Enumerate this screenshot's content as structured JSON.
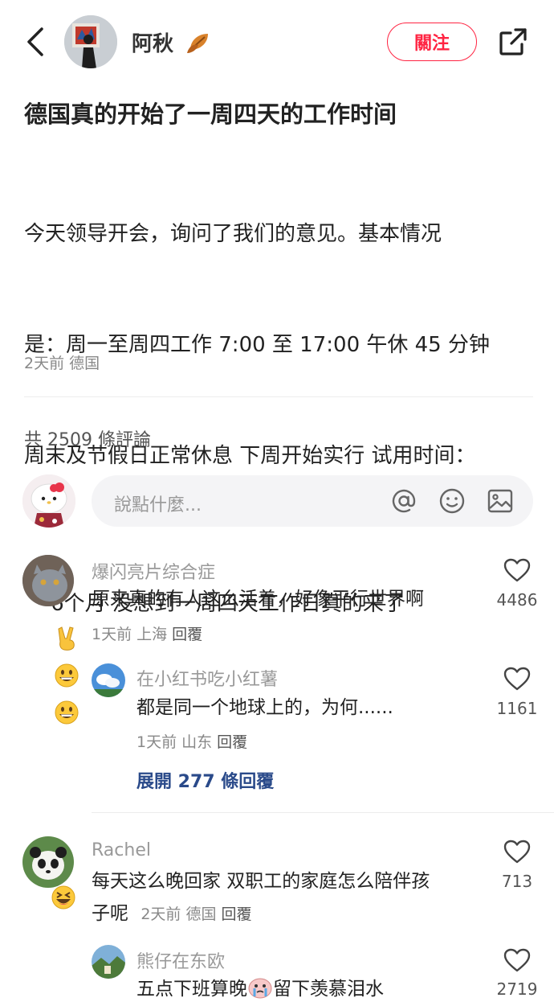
{
  "header": {
    "author_name": "阿秋",
    "follow_label": "關注"
  },
  "post": {
    "title": "德国真的开始了一周四天的工作时间",
    "body_line1": "今天领导开会，询问了我们的意见。基本情况",
    "body_line2": "是：周一至周四工作 7:00 至 17:00 午休 45 分钟",
    "body_line3": "周末及节假日正常休息 下周开始实行 试用时间：",
    "body_line4": "6个月 没想到一周四天工作日真的来了",
    "meta": "2天前 德国"
  },
  "comments_header": {
    "count_text": "共 2509 條評論"
  },
  "input": {
    "placeholder": "說點什麼..."
  },
  "comments": [
    {
      "name": "爆闪亮片综合症",
      "text": "原来真的有人这么活着，好像平行世界啊",
      "meta": "1天前 上海",
      "reply": "回覆",
      "likes": "4486",
      "replies": [
        {
          "name": "在小红书吃小红薯",
          "text": "都是同一个地球上的，为何......",
          "meta": "1天前 山东",
          "reply": "回覆",
          "likes": "1161"
        }
      ],
      "expand_text": "展開 277 條回覆"
    },
    {
      "name": "Rachel",
      "text_line1": "每天这么晚回家 双职工的家庭怎么陪伴孩",
      "text_line2": "子呢",
      "meta": "2天前 德国",
      "reply": "回覆",
      "likes": "713",
      "replies": [
        {
          "name": "熊仔在东欧",
          "text_a": "五点下班算晚",
          "text_b": "留下羡慕泪水",
          "likes": "2719"
        }
      ]
    }
  ],
  "colors": {
    "accent": "#ff2442",
    "link": "#2a4a8a"
  },
  "icons": [
    "back-icon",
    "share-icon",
    "at-icon",
    "smiley-icon",
    "image-icon",
    "heart-icon",
    "leaf-emoji",
    "victory-hand-emoji",
    "grinning-emoji",
    "laughing-emoji",
    "crying-emoji"
  ]
}
